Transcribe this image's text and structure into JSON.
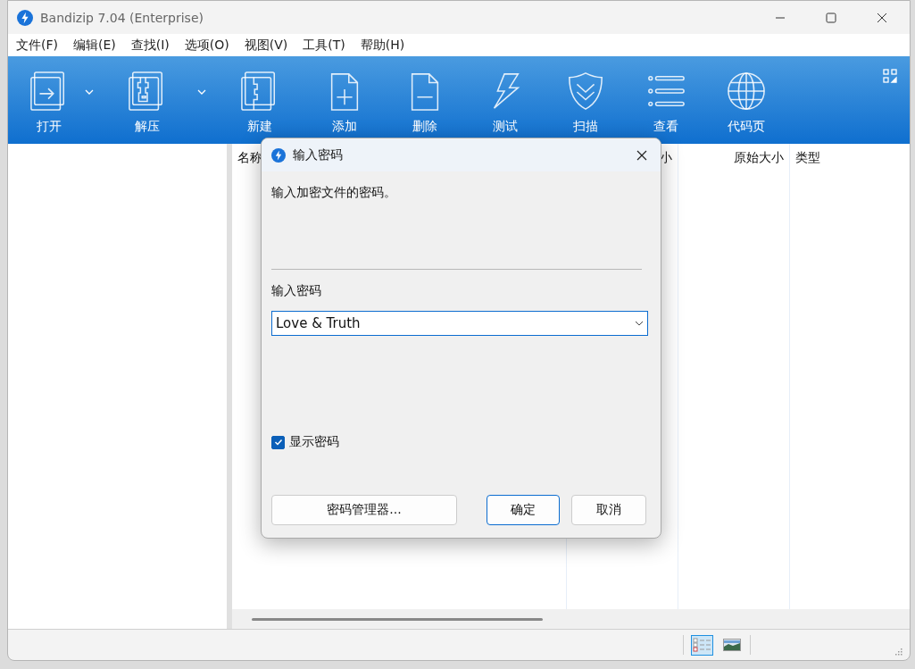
{
  "window": {
    "title": "Bandizip 7.04 (Enterprise)"
  },
  "menu": [
    "文件(F)",
    "编辑(E)",
    "查找(I)",
    "选项(O)",
    "视图(V)",
    "工具(T)",
    "帮助(H)"
  ],
  "toolbar": [
    {
      "kind": "open",
      "label": "打开",
      "dropdown": true
    },
    {
      "kind": "extract",
      "label": "解压",
      "dropdown": true
    },
    {
      "kind": "new",
      "label": "新建",
      "dropdown": false
    },
    {
      "kind": "add",
      "label": "添加",
      "dropdown": false
    },
    {
      "kind": "delete",
      "label": "删除",
      "dropdown": false
    },
    {
      "kind": "test",
      "label": "测试",
      "dropdown": false
    },
    {
      "kind": "scan",
      "label": "扫描",
      "dropdown": false
    },
    {
      "kind": "view",
      "label": "查看",
      "dropdown": false
    },
    {
      "kind": "codepage",
      "label": "代码页",
      "dropdown": false
    }
  ],
  "table": {
    "columns": [
      {
        "label": "名称"
      },
      {
        "label": "小"
      },
      {
        "label": "原始大小"
      },
      {
        "label": "类型"
      }
    ]
  },
  "status_bar": {
    "view_buttons": [
      {
        "kind": "details",
        "selected": true
      },
      {
        "kind": "thumbnails",
        "selected": false
      }
    ]
  },
  "dialog": {
    "title": "输入密码",
    "message": "输入加密文件的密码。",
    "field_label": "输入密码",
    "password": "Love & Truth",
    "show_password": {
      "label": "显示密码",
      "checked": true
    },
    "buttons": [
      {
        "label": "密码管理器...",
        "default": false
      },
      {
        "label": "确定",
        "default": true
      },
      {
        "label": "取消",
        "default": false
      }
    ]
  }
}
